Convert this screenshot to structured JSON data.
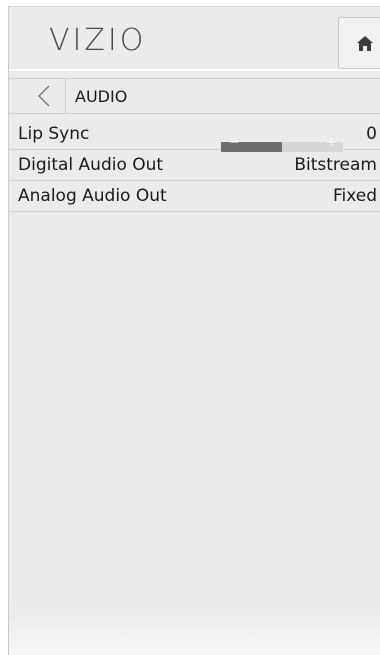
{
  "header": {
    "logo_text": "VIZIO",
    "home_icon": "home-icon"
  },
  "nav": {
    "back_icon": "back-arrow-icon",
    "title": "AUDIO"
  },
  "menu": {
    "items": [
      {
        "label": "Lip Sync",
        "value": "0",
        "slider": {
          "minus": "−",
          "plus": "+",
          "level": 0.5
        }
      },
      {
        "label": "Digital Audio Out",
        "value": "Bitstream"
      },
      {
        "label": "Analog Audio Out",
        "value": "Fixed"
      }
    ]
  },
  "colors": {
    "panel_bg": "#ebebeb",
    "text": "#1a1a1a",
    "slider_fill": "#6e6e6e",
    "slider_track": "#d6d6d6"
  }
}
